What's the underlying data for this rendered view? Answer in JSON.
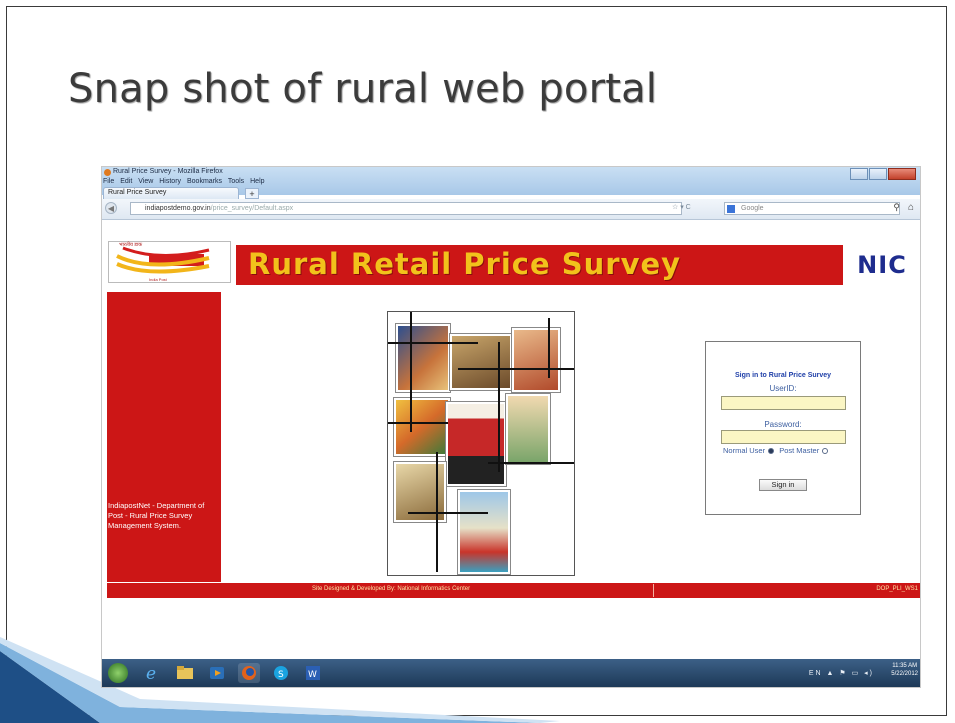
{
  "slide": {
    "title": "Snap shot of rural web portal"
  },
  "browser": {
    "window_title": "Rural Price Survey - Mozilla Firefox",
    "menu": [
      "File",
      "Edit",
      "View",
      "History",
      "Bookmarks",
      "Tools",
      "Help"
    ],
    "tab_label": "Rural Price Survey",
    "new_tab": "+",
    "url_host": "indiapostdemo.gov.in",
    "url_path": "/price_survey/Default.aspx",
    "search_placeholder": "Google"
  },
  "page": {
    "logo_hindi": "भारतीय डाक",
    "logo_sub": "India Post",
    "banner_title": "Rural Retail Price Survey",
    "nic_logo": "NIC",
    "left_text": "IndiapostNet - Department of Post - Rural Price Survey Management System.",
    "signin": {
      "title": "Sign in to Rural Price Survey",
      "userid_label": "UserID:",
      "password_label": "Password:",
      "radio_normal": "Normal User",
      "radio_postmaster": "Post Master",
      "button": "Sign in"
    },
    "footer_text": "Site Designed & Developed By: National Informatics Center",
    "footer_code": "DOP_PLI_WS1"
  },
  "taskbar": {
    "lang": "EN",
    "time": "11:35 AM",
    "date": "5/22/2012"
  },
  "colors": {
    "banner_red": "#cc1616",
    "banner_text": "#f2c21b",
    "nic_blue": "#1e2c8e",
    "input_yellow": "#fbf6c4"
  }
}
